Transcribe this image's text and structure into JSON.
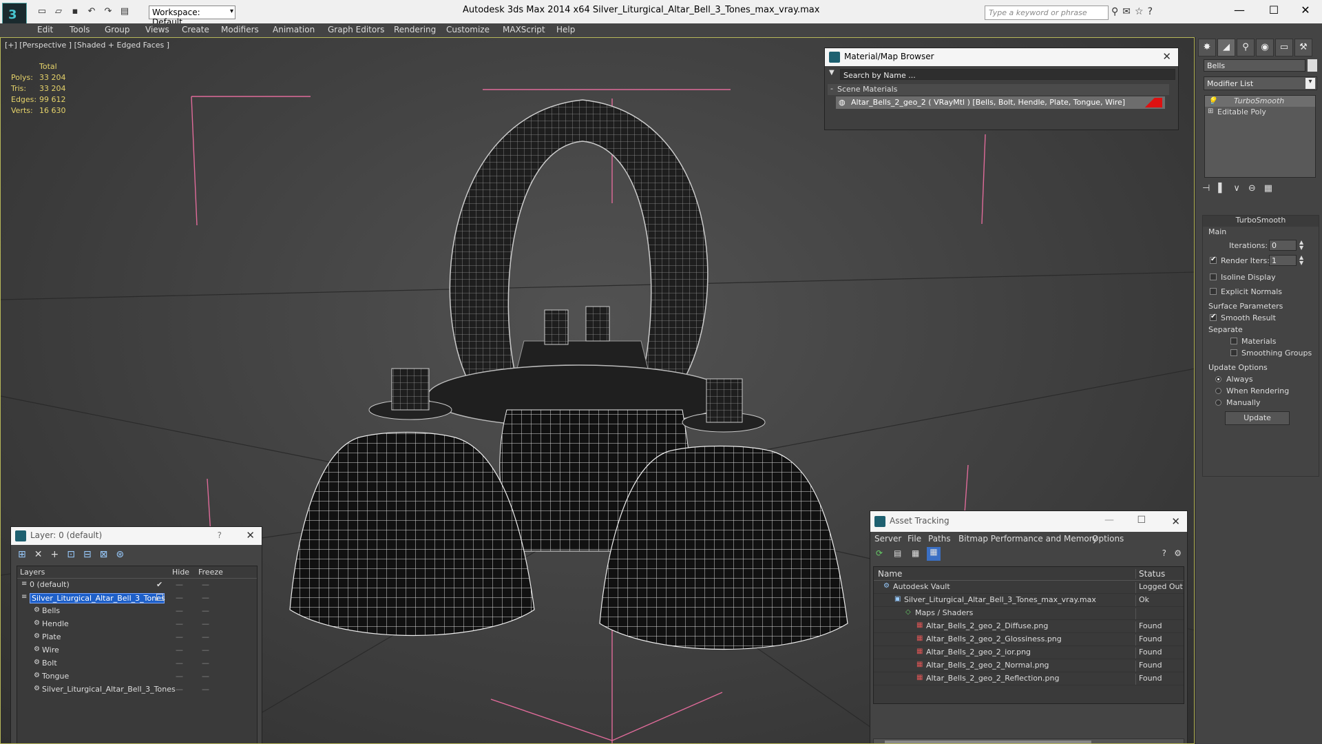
{
  "app": {
    "workspace": "Workspace: Default",
    "title": "Autodesk 3ds Max  2014 x64        Silver_Liturgical_Altar_Bell_3_Tones_max_vray.max",
    "search_placeholder": "Type a keyword or phrase"
  },
  "menu": [
    "Edit",
    "Tools",
    "Group",
    "Views",
    "Create",
    "Modifiers",
    "Animation",
    "Graph Editors",
    "Rendering",
    "Customize",
    "MAXScript",
    "Help"
  ],
  "viewport": {
    "label": "[+] [Perspective ] [Shaded + Edged Faces ]",
    "stats": {
      "header": "Total",
      "rows": [
        {
          "k": "Polys:",
          "v": "33 204"
        },
        {
          "k": "Tris:",
          "v": "33 204"
        },
        {
          "k": "Edges:",
          "v": "99 612"
        },
        {
          "k": "Verts:",
          "v": "16 630"
        }
      ]
    }
  },
  "material_browser": {
    "title": "Material/Map Browser",
    "search": "Search by Name ...",
    "section": "Scene Materials",
    "item": "Altar_Bells_2_geo_2  ( VRayMtl )  [Bells, Bolt, Hendle, Plate, Tongue, Wire]"
  },
  "command_panel": {
    "object_name": "Bells",
    "modifier_list": "Modifier List",
    "stack": [
      "TurboSmooth",
      "Editable Poly"
    ],
    "turbosmooth": {
      "title": "TurboSmooth",
      "main": "Main",
      "iterations_label": "Iterations:",
      "iterations": "0",
      "render_iters_label": "Render Iters:",
      "render_iters": "1",
      "isoline": "Isoline Display",
      "explicit": "Explicit Normals",
      "surface": "Surface Parameters",
      "smooth_result": "Smooth Result",
      "separate": "Separate",
      "materials": "Materials",
      "smoothing_groups": "Smoothing Groups",
      "update_options": "Update Options",
      "always": "Always",
      "when_rendering": "When Rendering",
      "manually": "Manually",
      "update": "Update"
    }
  },
  "layer_panel": {
    "title": "Layer: 0 (default)",
    "help": "?",
    "col_layers": "Layers",
    "col_hide": "Hide",
    "col_freeze": "Freeze",
    "rows": [
      {
        "name": "0 (default)",
        "indent": 0
      },
      {
        "name": "Silver_Liturgical_Altar_Bell_3_Tones",
        "indent": 0
      },
      {
        "name": "Bells",
        "indent": 1
      },
      {
        "name": "Hendle",
        "indent": 1
      },
      {
        "name": "Plate",
        "indent": 1
      },
      {
        "name": "Wire",
        "indent": 1
      },
      {
        "name": "Bolt",
        "indent": 1
      },
      {
        "name": "Tongue",
        "indent": 1
      },
      {
        "name": "Silver_Liturgical_Altar_Bell_3_Tones",
        "indent": 1
      }
    ]
  },
  "asset_tracking": {
    "title": "Asset Tracking",
    "menu": [
      "Server",
      "File",
      "Paths",
      "Bitmap Performance and Memory",
      "Options"
    ],
    "col_name": "Name",
    "col_status": "Status",
    "rows": [
      {
        "name": "Autodesk Vault",
        "status": "Logged Out",
        "indent": 1
      },
      {
        "name": "Silver_Liturgical_Altar_Bell_3_Tones_max_vray.max",
        "status": "Ok",
        "indent": 2
      },
      {
        "name": "Maps / Shaders",
        "status": "",
        "indent": 3
      },
      {
        "name": "Altar_Bells_2_geo_2_Diffuse.png",
        "status": "Found",
        "indent": 4
      },
      {
        "name": "Altar_Bells_2_geo_2_Glossiness.png",
        "status": "Found",
        "indent": 4
      },
      {
        "name": "Altar_Bells_2_geo_2_ior.png",
        "status": "Found",
        "indent": 4
      },
      {
        "name": "Altar_Bells_2_geo_2_Normal.png",
        "status": "Found",
        "indent": 4
      },
      {
        "name": "Altar_Bells_2_geo_2_Reflection.png",
        "status": "Found",
        "indent": 4
      }
    ]
  }
}
